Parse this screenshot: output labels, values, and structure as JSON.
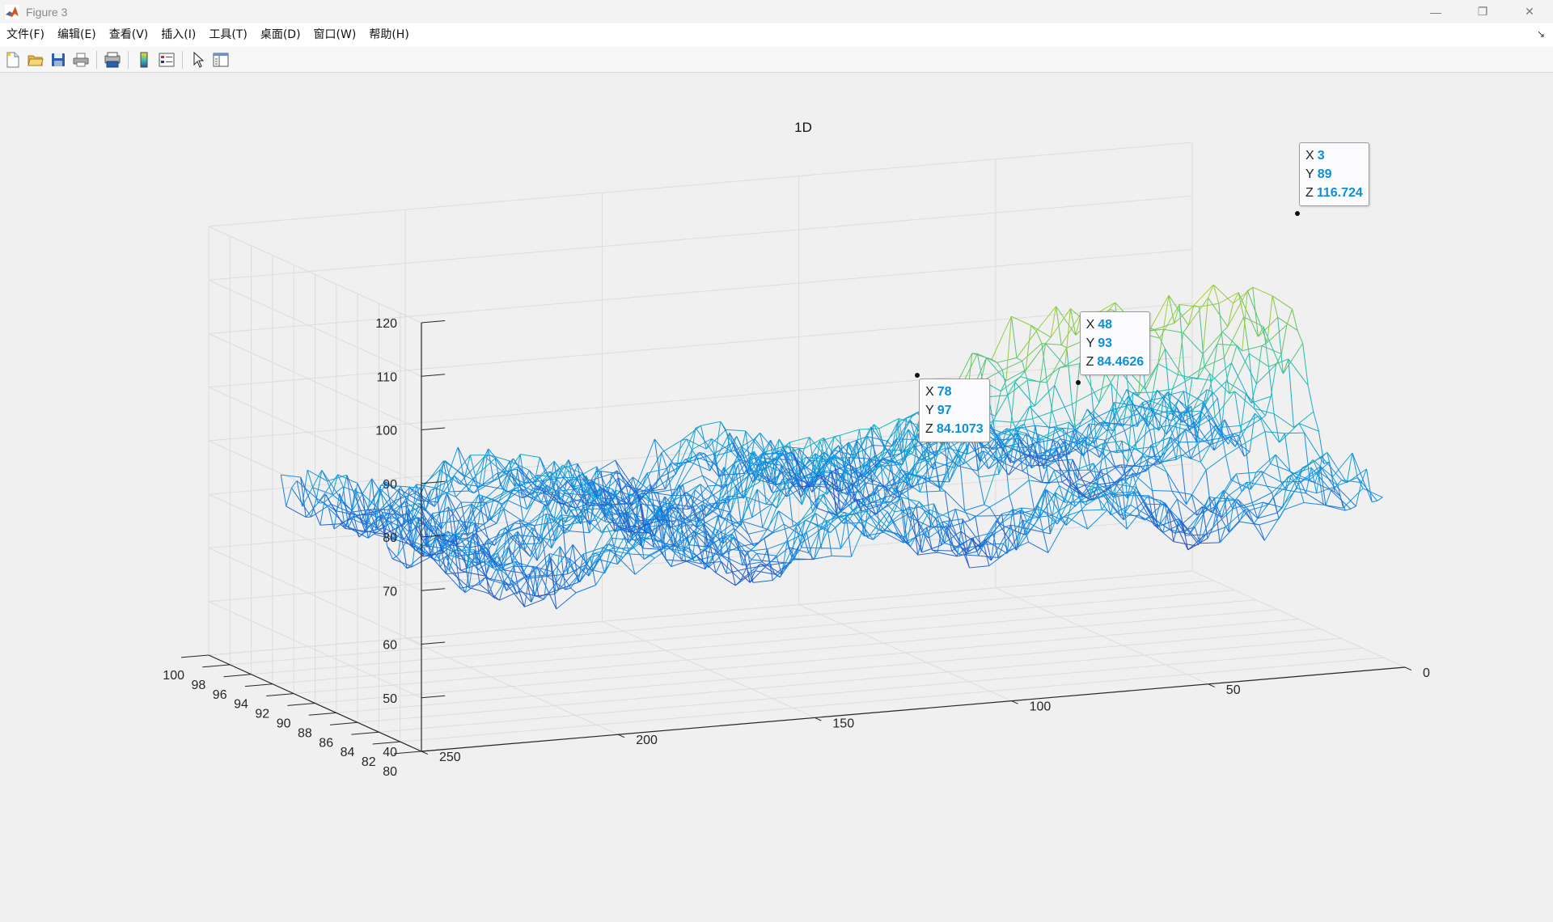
{
  "window": {
    "title": "Figure 3",
    "controls": {
      "minimize": "—",
      "maximize": "❐",
      "close": "✕"
    }
  },
  "menu": {
    "items": [
      "文件(F)",
      "编辑(E)",
      "查看(V)",
      "插入(I)",
      "工具(T)",
      "桌面(D)",
      "窗口(W)",
      "帮助(H)"
    ],
    "dock_arrow": "↘"
  },
  "toolbar": {
    "buttons": [
      "new-figure",
      "open-file",
      "save",
      "print",
      "print-preview",
      "colorbar",
      "legend",
      "edit-plot",
      "property-inspector"
    ]
  },
  "chart_data": {
    "type": "mesh3d",
    "title": "1D",
    "xlabel": "",
    "ylabel": "",
    "zlabel": "",
    "x_ticks": [
      0,
      50,
      100,
      150,
      200,
      250
    ],
    "y_ticks": [
      80,
      82,
      84,
      86,
      88,
      90,
      92,
      94,
      96,
      98,
      100
    ],
    "z_ticks": [
      40,
      50,
      60,
      70,
      80,
      90,
      100,
      110,
      120
    ],
    "xlim": [
      0,
      250
    ],
    "ylim": [
      80,
      100
    ],
    "zlim": [
      40,
      120
    ],
    "grid": true,
    "colormap": "parula",
    "datatips": [
      {
        "x": 3,
        "y": 89,
        "z": 116.724
      },
      {
        "x": 48,
        "y": 93,
        "z": 84.4626
      },
      {
        "x": 78,
        "y": 97,
        "z": 84.1073
      }
    ]
  }
}
